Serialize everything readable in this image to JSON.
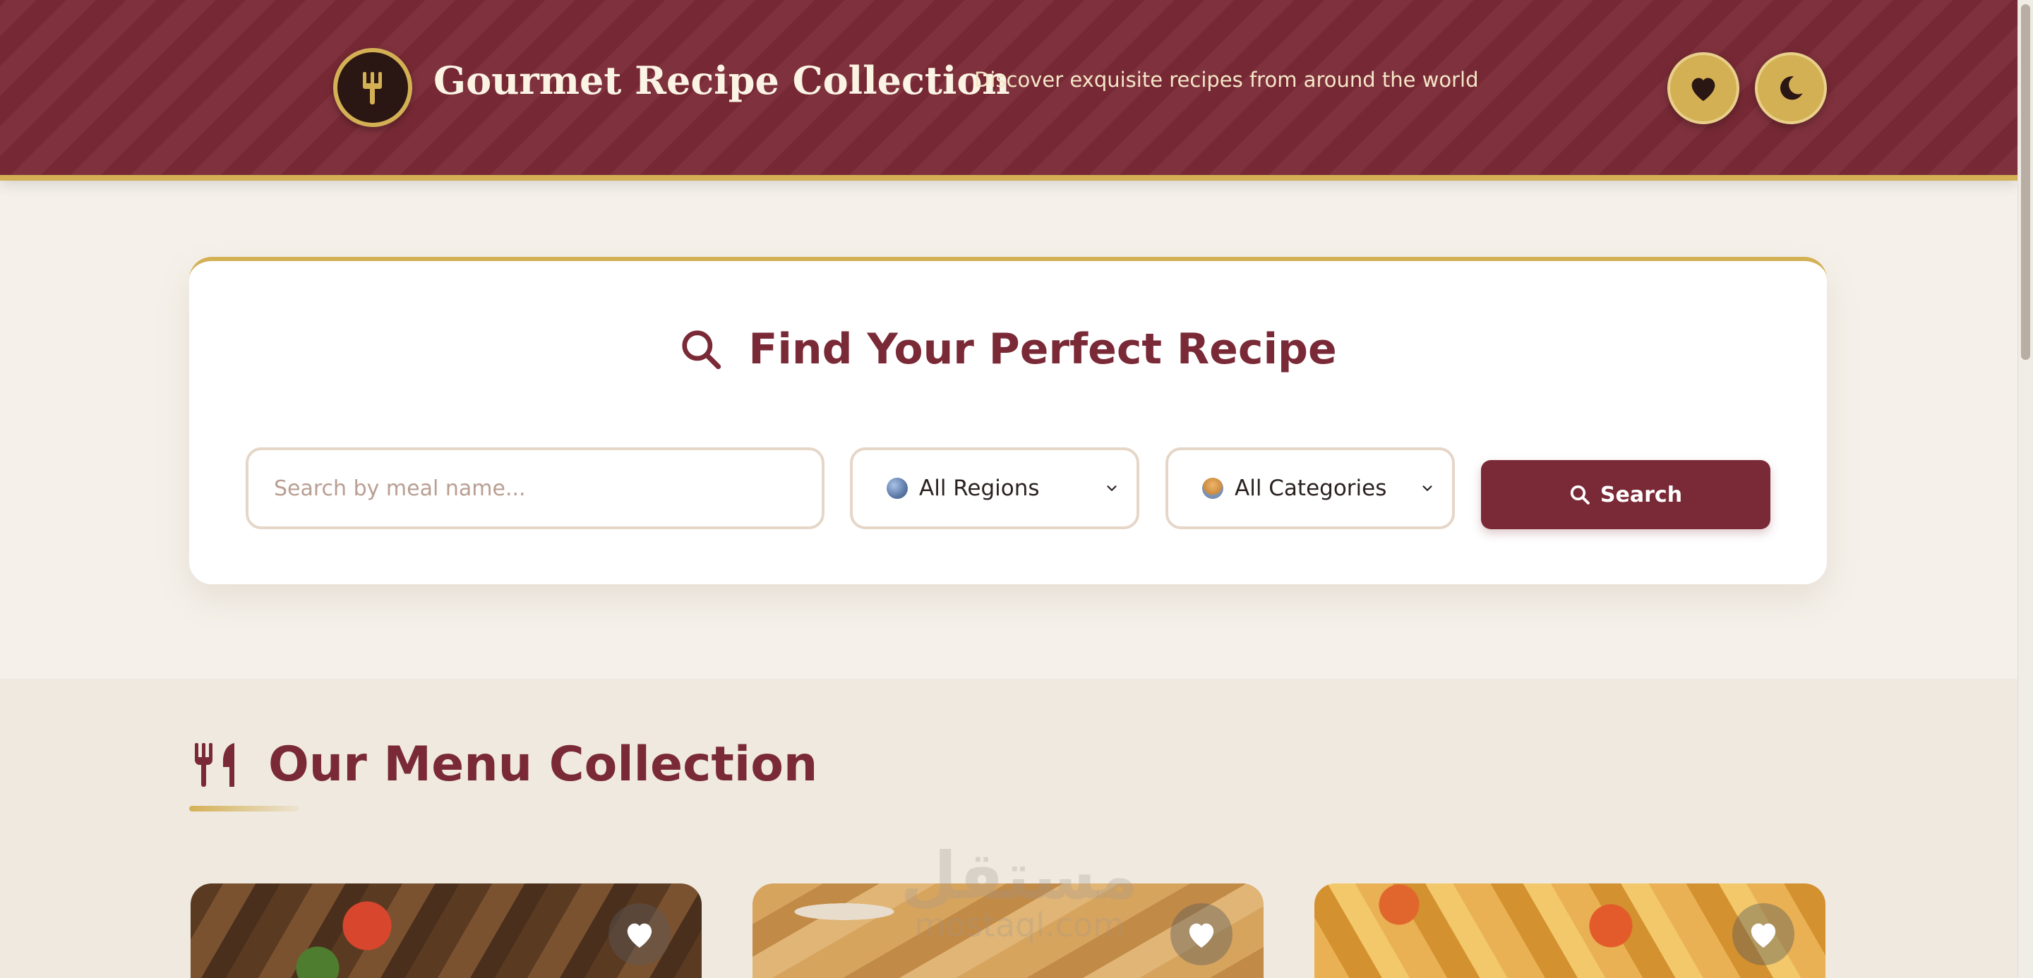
{
  "header": {
    "title": "Gourmet Recipe Collection",
    "tagline": "Discover exquisite recipes from around the world",
    "logo_icon": "fork-icon",
    "favorites_button_icon": "heart-icon",
    "theme_toggle_icon": "moon-icon"
  },
  "search": {
    "heading": "Find Your Perfect Recipe",
    "heading_icon": "search-icon",
    "input_placeholder": "Search by meal name...",
    "input_value": "",
    "region_select": {
      "selected": "All Regions",
      "emoji_icon": "globe-icon"
    },
    "category_select": {
      "selected": "All Categories",
      "emoji_icon": "dish-icon"
    },
    "button_label": "Search"
  },
  "menu": {
    "heading": "Our Menu Collection",
    "heading_icon": "utensils-icon",
    "cards": [
      {
        "image": "kebab-skewers-photo",
        "favorite_icon": "heart-icon"
      },
      {
        "image": "spring-rolls-photo",
        "favorite_icon": "heart-icon"
      },
      {
        "image": "spiced-potatoes-photo",
        "favorite_icon": "heart-icon"
      }
    ]
  },
  "watermark": {
    "arabic": "مستقل",
    "url": "mostaql.com"
  },
  "colors": {
    "primary": "#7a2a36",
    "gold": "#d4b055",
    "background": "#f5f1ea",
    "card": "#ffffff"
  }
}
